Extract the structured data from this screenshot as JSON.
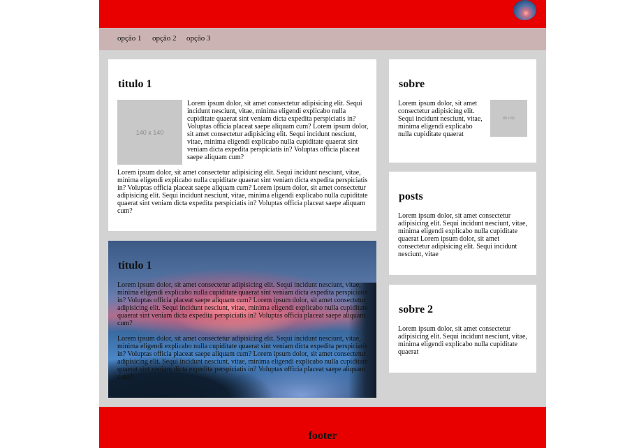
{
  "header": {
    "avatar_icon": "user-avatar-icon",
    "color": "#e80000"
  },
  "nav": {
    "items": [
      {
        "label": "opção 1"
      },
      {
        "label": "opção 2"
      },
      {
        "label": "opção 3"
      }
    ]
  },
  "main": {
    "card1": {
      "title": "titulo 1",
      "placeholder_label": "140 x 140",
      "paragraph1": "Lorem ipsum dolor, sit amet consectetur adipisicing elit. Sequi incidunt nesciunt, vitae, minima eligendi explicabo nulla cupiditate quaerat sint veniam dicta expedita perspiciatis in? Voluptas officia placeat saepe aliquam cum? Lorem ipsum dolor, sit amet consectetur adipisicing elit. Sequi incidunt nesciunt, vitae, minima eligendi explicabo nulla cupiditate quaerat sint veniam dicta expedita perspiciatis in? Voluptas officia placeat saepe aliquam cum?",
      "paragraph2": "Lorem ipsum dolor, sit amet consectetur adipisicing elit. Sequi incidunt nesciunt, vitae, minima eligendi explicabo nulla cupiditate quaerat sint veniam dicta expedita perspiciatis in? Voluptas officia placeat saepe aliquam cum? Lorem ipsum dolor, sit amet consectetur adipisicing elit. Sequi incidunt nesciunt, vitae, minima eligendi explicabo nulla cupiditate quaerat sint veniam dicta expedita perspiciatis in? Voluptas officia placeat saepe aliquam cum?"
    },
    "card2": {
      "title": "titulo 1",
      "paragraph1": "Lorem ipsum dolor, sit amet consectetur adipisicing elit. Sequi incidunt nesciunt, vitae, minima eligendi explicabo nulla cupiditate quaerat sint veniam dicta expedita perspiciatis in? Voluptas officia placeat saepe aliquam cum? Lorem ipsum dolor, sit amet consectetur adipisicing elit. Sequi incidunt nesciunt, vitae, minima eligendi explicabo nulla cupiditate quaerat sint veniam dicta expedita perspiciatis in? Voluptas officia placeat saepe aliquam cum?",
      "paragraph2": "Lorem ipsum dolor, sit amet consectetur adipisicing elit. Sequi incidunt nesciunt, vitae, minima eligendi explicabo nulla cupiditate quaerat sint veniam dicta expedita perspiciatis in? Voluptas officia placeat saepe aliquam cum? Lorem ipsum dolor, sit amet consectetur adipisicing elit. Sequi incidunt nesciunt, vitae, minima eligendi explicabo nulla cupiditate quaerat sint veniam dicta expedita perspiciatis in? Voluptas officia placeat saepe aliquam cum?"
    }
  },
  "sidebar": {
    "about": {
      "title": "sobre",
      "placeholder_label": "80 x 80",
      "text": "Lorem ipsum dolor, sit amet consectetur adipisicing elit. Sequi incidunt nesciunt, vitae, minima eligendi explicabo nulla cupiditate quaerat"
    },
    "posts": {
      "title": "posts",
      "text": "Lorem ipsum dolor, sit amet consectetur adipisicing elit. Sequi incidunt nesciunt, vitae, minima eligendi explicabo nulla cupiditate quaerat Lorem ipsum dolor, sit amet consectetur adipisicing elit. Sequi incidunt nesciunt, vitae"
    },
    "about2": {
      "title": "sobre 2",
      "text": "Lorem ipsum dolor, sit amet consectetur adipisicing elit. Sequi incidunt nesciunt, vitae, minima eligendi explicabo nulla cupiditate quaerat"
    }
  },
  "footer": {
    "label": "footer",
    "color": "#e80000"
  }
}
